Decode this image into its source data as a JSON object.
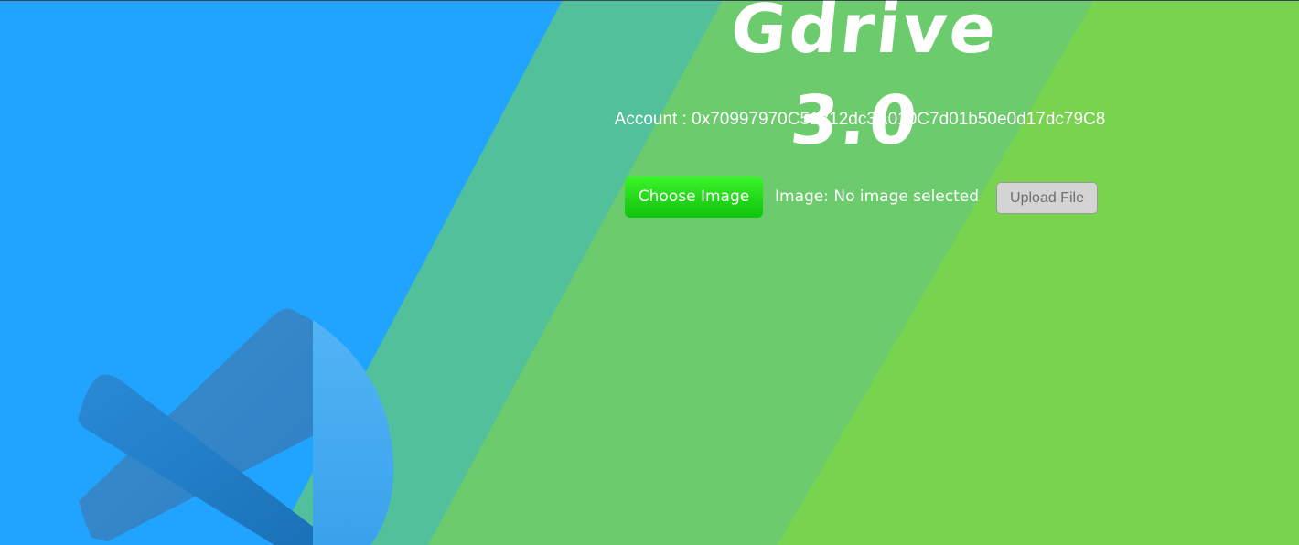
{
  "app": {
    "title": "Gdrive 3.0"
  },
  "account": {
    "text": "Account : 0x70997970C51812dc3A010C7d01b50e0d17dc79C8"
  },
  "upload_form": {
    "choose_label": "Choose Image",
    "status_text": "Image: No image selected",
    "upload_label": "Upload File"
  },
  "icons": {
    "logo": "vscode-logo-icon"
  },
  "colors": {
    "background_blue": "#20a4ff",
    "stripe_teal": "#52c19b",
    "stripe_green": "#6ccb6c",
    "background_green": "#78d34e",
    "choose_button": "#22d61a",
    "upload_button": "#d4d4d4",
    "text": "#ffffff"
  }
}
